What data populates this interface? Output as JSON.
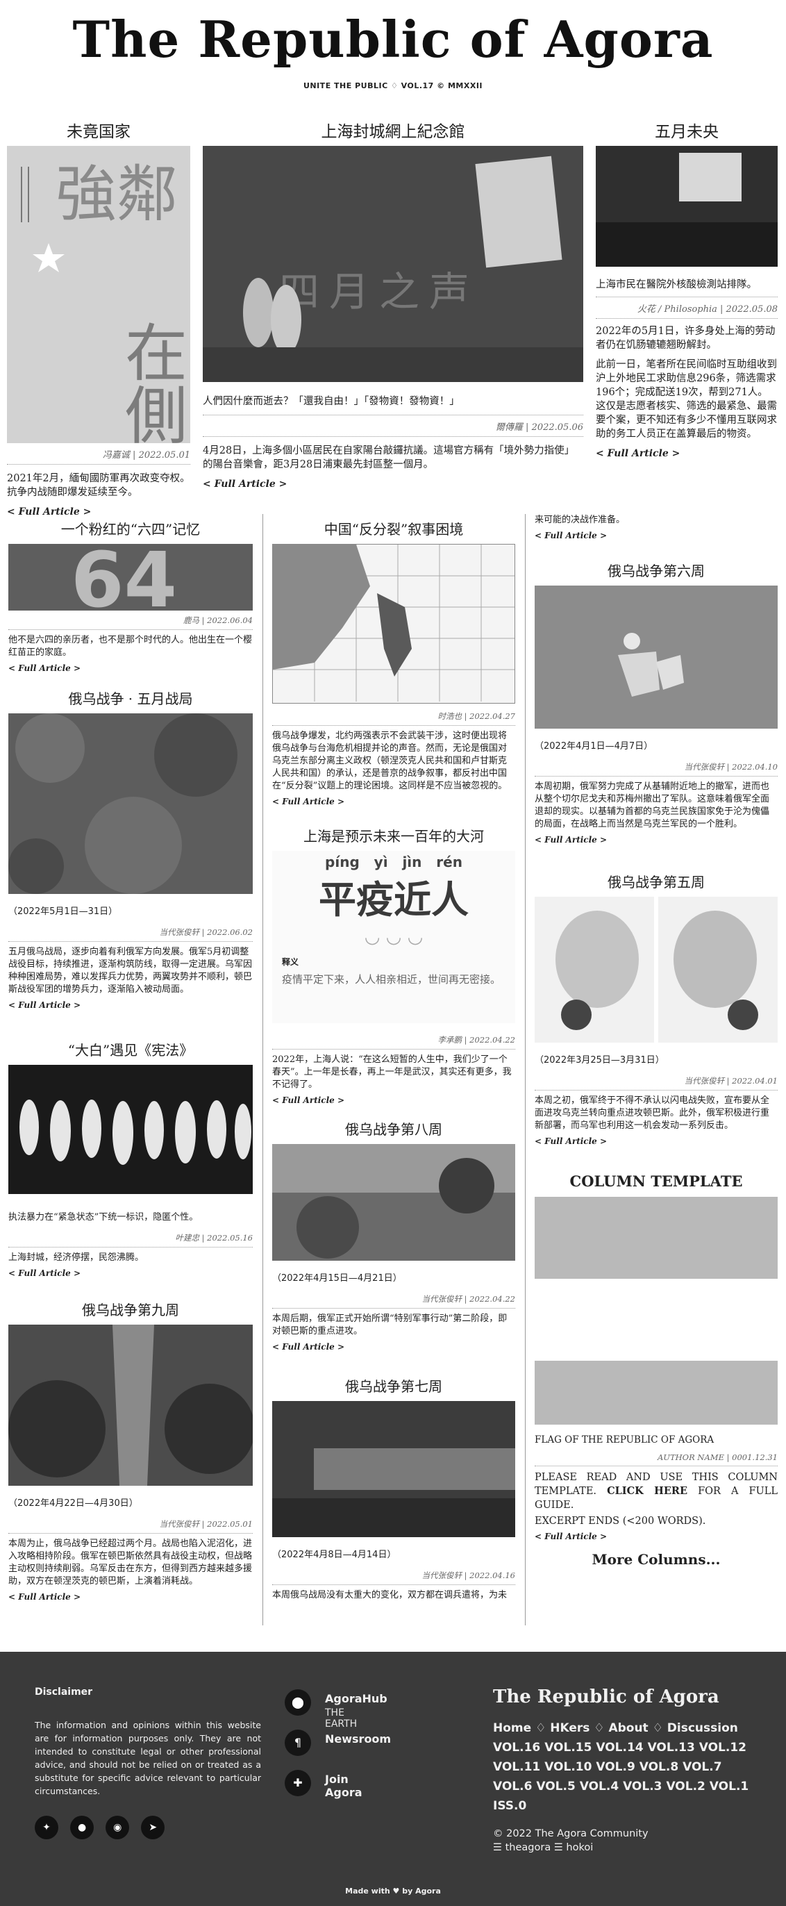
{
  "masthead": {
    "title": "The Republic of Agora",
    "tagline": "UNITE THE PUBLIC ♢ VOL.17 © MMXXII"
  },
  "top": [
    {
      "title": "未竟国家",
      "byline": "冯嘉诚 | 2022.05.01",
      "excerpt": "2021年2月，緬甸國防軍再次政变夺权。抗争内战随即爆发延续至今。",
      "more": "< Full Article >"
    },
    {
      "title": "上海封城網上紀念館",
      "caption": "人們因什麼而逝去？「還我自由！」「發物資！發物資！」",
      "byline": "爾傳羅 | 2022.05.06",
      "excerpt": "4月28日，上海多個小區居民在自家陽台敲鑼抗議。這場官方稱有「境外勢力指使」的陽台音樂會，距3月28日浦東最先封區整一個月。",
      "more": "< Full Article >"
    },
    {
      "title": "五月未央",
      "caption": "上海市民在醫院外核酸檢測站排隊。",
      "byline": "火花 / Philosophia | 2022.05.08",
      "excerpt1": "2022年の5月1日，许多身处上海的劳动者仍在饥肠辘辘翘盼解封。",
      "excerpt2": "此前一日，笔者所在民间临时互助组收到沪上外地民工求助信息296条，筛选需求196个；完成配送19次，帮到271人。这仅是志愿者核实、筛选的最紧急、最需要个案，更不知还有多少不懂用互联网求助的务工人员正在盖算最后的物资。",
      "more": "< Full Article >"
    }
  ],
  "cards": {
    "c1a": {
      "title": "一个粉红的“六四”记忆",
      "byline": "鹿马 | 2022.06.04",
      "excerpt": "他不是六四的亲历者，也不是那个时代的人。他出生在一个樱红苗正的家庭。",
      "more": "< Full Article >",
      "badge": "64"
    },
    "c1b": {
      "title": "俄乌战争 · 五月战局",
      "period": "（2022年5月1日—31日）",
      "byline": "当代张俊轩 | 2022.06.02",
      "excerpt": "五月俄乌战局，逐步向着有利俄军方向发展。俄军5月初调整战役目标，持续推进，逐渐构筑防线，取得一定进展。乌军因种种困难局势，难以发挥兵力优势，两翼攻势并不顺利，顿巴斯战役军团的增势兵力，逐渐陷入被动局面。",
      "more": "< Full Article >"
    },
    "c1c": {
      "title": "“大白”遇见《宪法》",
      "caption": "执法暴力在“紧急状态”下统一标识，隐匿个性。",
      "byline": "叶建忠 | 2022.05.16",
      "excerpt": "上海封城，经济停摆，民怨沸腾。",
      "more": "< Full Article >"
    },
    "c1d": {
      "title": "俄乌战争第九周",
      "period": "（2022年4月22日—4月30日）",
      "byline": "当代张俊轩 | 2022.05.01",
      "excerpt": "本周为止，俄乌战争已经超过两个月。战局也陷入泥沼化，进入攻略相持阶段。俄军在顿巴斯依然具有战役主动权，但战略主动权则持续削弱。乌军反击在东方，但得到西方越来越多援助，双方在顿涅茨克的顿巴斯，上演着消耗战。",
      "more": "< Full Article >"
    },
    "c2a": {
      "title": "中国“反分裂”叙事困境",
      "byline": "时浩也 | 2022.04.27",
      "excerpt": "俄乌战争爆发，北约两强表示不会武装干涉，这时便出现将俄乌战争与台海危机相提并论的声音。然而，无论是俄国对乌克兰东部分离主义政权（顿涅茨克人民共和国和卢甘斯克人民共和国）的承认，还是普京的战争叙事，都反衬出中国在“反分裂”议题上的理论困境。这同样是不应当被忽视的。",
      "more": "< Full Article >"
    },
    "c2b": {
      "title": "上海是预示未来一百年的大河",
      "pinyin": "píng   yì   jìn   rén",
      "slogan": "平疫近人",
      "defTerm": "释义",
      "defText": "疫情平定下来，人人相亲相近，世间再无密接。",
      "byline": "李承鹏 | 2022.04.22",
      "excerpt": "2022年，上海人说：“在这么短暂的人生中，我们少了一个春天”。上一年是长春，再上一年是武汉，其实还有更多，我不记得了。",
      "more": "< Full Article >"
    },
    "c2c": {
      "title": "俄乌战争第八周",
      "period": "（2022年4月15日—4月21日）",
      "byline": "当代张俊轩 | 2022.04.22",
      "excerpt": "本周后期，俄军正式开始所谓“特别军事行动”第二阶段，即对顿巴斯的重点进攻。",
      "more": "< Full Article >"
    },
    "c2d": {
      "title": "俄乌战争第七周",
      "period": "（2022年4月8日—4月14日）",
      "byline": "当代张俊轩 | 2022.04.16",
      "excerpt": "本周俄乌战局没有太重大的变化，双方都在调兵遣将，为未"
    },
    "c3top": {
      "excerpt": "来可能的决战作准备。",
      "more": "< Full Article >"
    },
    "c3a": {
      "title": "俄乌战争第六周",
      "period": "（2022年4月1日—4月7日）",
      "byline": "当代张俊轩 | 2022.04.10",
      "excerpt": "本周初期，俄军努力完成了从基辅附近地上的撤军，进而也从整个切尔尼戈夫和苏梅州撤出了军队。这意味着俄军全面退却的现实。以基辅为首都的乌克兰民族国家免于沦为傀儡的局面，在战略上而当然是乌克兰军民的一个胜利。",
      "more": "< Full Article >"
    },
    "c3b": {
      "title": "俄乌战争第五周",
      "period": "（2022年3月25日—3月31日）",
      "byline": "当代张俊轩 | 2022.04.01",
      "excerpt": "本周之初，俄军终于不得不承认以闪电战失败，宣布要从全面进攻乌克兰转向重点进攻顿巴斯。此外，俄军积极进行重新部署，而乌军也利用这一机会发动一系列反击。",
      "more": "< Full Article >"
    },
    "c3c": {
      "title": "COLUMN TEMPLATE",
      "caption": "FLAG OF THE REPUBLIC OF AGORA",
      "byline": "AUTHOR NAME | 0001.12.31",
      "excerptA": "PLEASE READ AND USE THIS COLUMN TEMPLATE. ",
      "excerptLink": "CLICK HERE",
      "excerptB": " FOR A FULL GUIDE.",
      "excerpt2": "EXCERPT ENDS (<200 WORDS).",
      "more": "< Full Article >",
      "moreColumns": "More Columns..."
    }
  },
  "footer": {
    "disclaimer_title": "Disclaimer",
    "disclaimer_text": "The information and opinions within this website are for information purposes only. They are not intended to constitute legal or other professional advice, and should not be relied on or treated as a substitute for specific advice relevant to particular circumstances.",
    "links": [
      {
        "label": "AgoraHub",
        "sub": "THE EARTH",
        "icon": "location-pin-icon"
      },
      {
        "label": "Newsroom",
        "sub": "",
        "icon": "pilcrow-icon"
      },
      {
        "label": "Join Agora",
        "sub": "",
        "icon": "puzzle-icon"
      }
    ],
    "socials": [
      "twitter-icon",
      "github-icon",
      "reddit-icon",
      "telegram-icon"
    ],
    "brand": "The Republic of Agora",
    "nav": [
      "Home",
      "HKers",
      "About",
      "Discussion"
    ],
    "vols": [
      "VOL.16",
      "VOL.15",
      "VOL.14",
      "VOL.13",
      "VOL.12",
      "VOL.11",
      "VOL.10",
      "VOL.9",
      "VOL.8",
      "VOL.7",
      "VOL.6",
      "VOL.5",
      "VOL.4",
      "VOL.3",
      "VOL.2",
      "VOL.1",
      "ISS.0"
    ],
    "copyright": "© 2022 The Agora Community",
    "handles": "☰ theagora ☰ hokoi",
    "made": "Made with ♥ by Agora"
  }
}
